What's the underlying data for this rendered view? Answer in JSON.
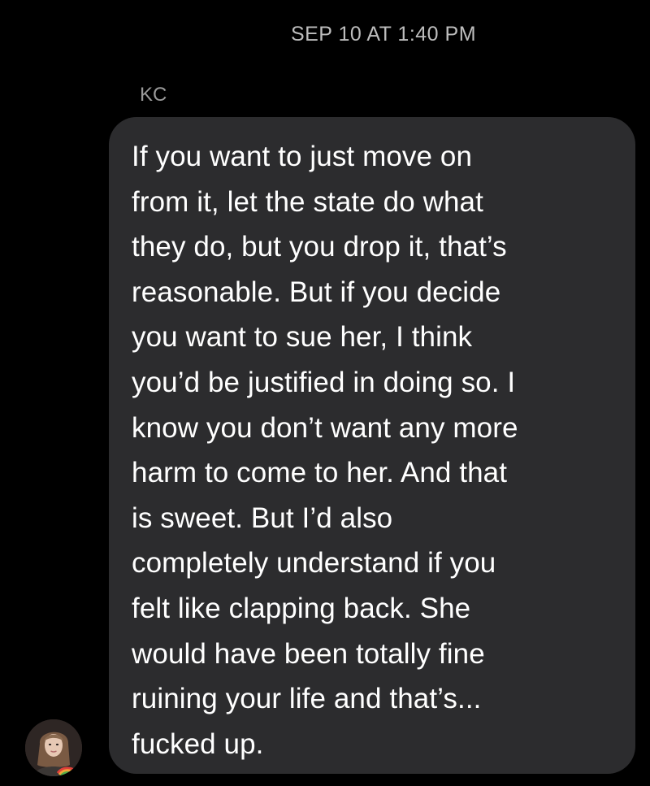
{
  "conversation": {
    "timestamp": "SEP 10 AT 1:40 PM",
    "sender_name": "KC",
    "message": {
      "text": "If you want to just move on\nfrom it, let the state do what\nthey do, but you drop it, that’s\nreasonable. But if you decide\nyou want to sue her, I think\nyou’d be justified in doing so. I\nknow you don’t want any more\nharm to come to her. And that\nis sweet. But I’d also\ncompletely understand if you\nfelt like clapping back. She\nwould have been totally fine\nruining your life and that’s...\nfucked up."
    }
  },
  "colors": {
    "background": "#000000",
    "bubble": "#2c2c2e",
    "message_text": "#ffffff",
    "timestamp_text": "#bdbdbd",
    "sender_text": "#9a9a9a"
  },
  "icons": {
    "avatar": "user-profile-photo-avatar"
  }
}
